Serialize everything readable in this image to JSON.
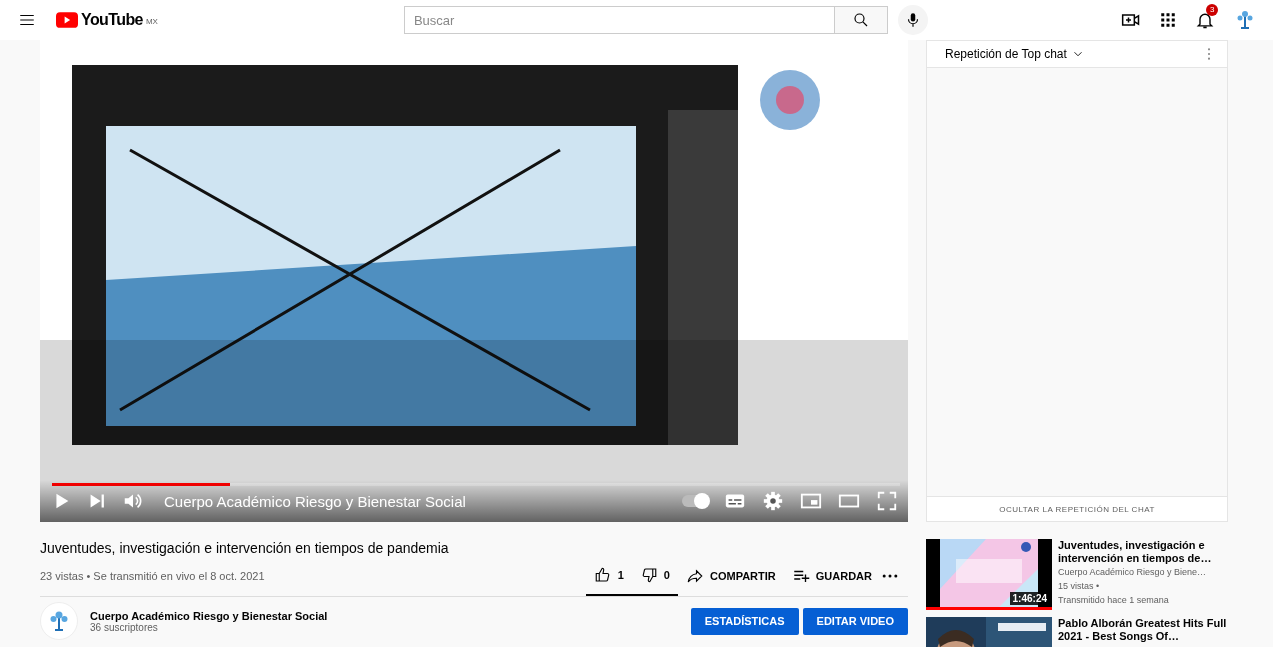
{
  "header": {
    "logo": "YouTube",
    "country": "MX",
    "search": {
      "placeholder": "Buscar"
    },
    "notifications": "3"
  },
  "player": {
    "overlay_title": "Cuerpo Académico Riesgo y Bienestar Social",
    "progress": {
      "level": 0.21
    },
    "autoplay": {
      "on": true
    }
  },
  "video": {
    "title": "Juventudes, investigación e intervención en tiempos de pandemia",
    "meta": "23 vistas • Se transmitió en vivo el 8 oct. 2021",
    "actions": [
      {
        "kind": "like",
        "label": "1"
      },
      {
        "kind": "dislike",
        "label": "0"
      },
      {
        "kind": "share",
        "label": "COMPARTIR"
      },
      {
        "kind": "save",
        "label": "GUARDAR"
      },
      {
        "kind": "more"
      }
    ]
  },
  "channel": {
    "name": "Cuerpo Académico Riesgo y Bienestar Social",
    "subscribers": "36 suscriptores",
    "buttons": [
      "ESTADÍSTICAS",
      "EDITAR VIDEO"
    ]
  },
  "chat": {
    "title": "Repetición de Top chat",
    "hide_button": "OCULTAR LA REPETICIÓN DEL CHAT"
  },
  "recommendations": [
    {
      "title": "Juventudes, investigación e intervención en tiempos de…",
      "channel": "Cuerpo Académico Riesgo y Biene…",
      "views": "15 vistas •",
      "age": "Transmitido hace 1 semana",
      "duration": "1:46:24",
      "level": 1
    },
    {
      "title": "Pablo Alborán Greatest Hits Full 2021 - Best Songs Of…"
    }
  ]
}
